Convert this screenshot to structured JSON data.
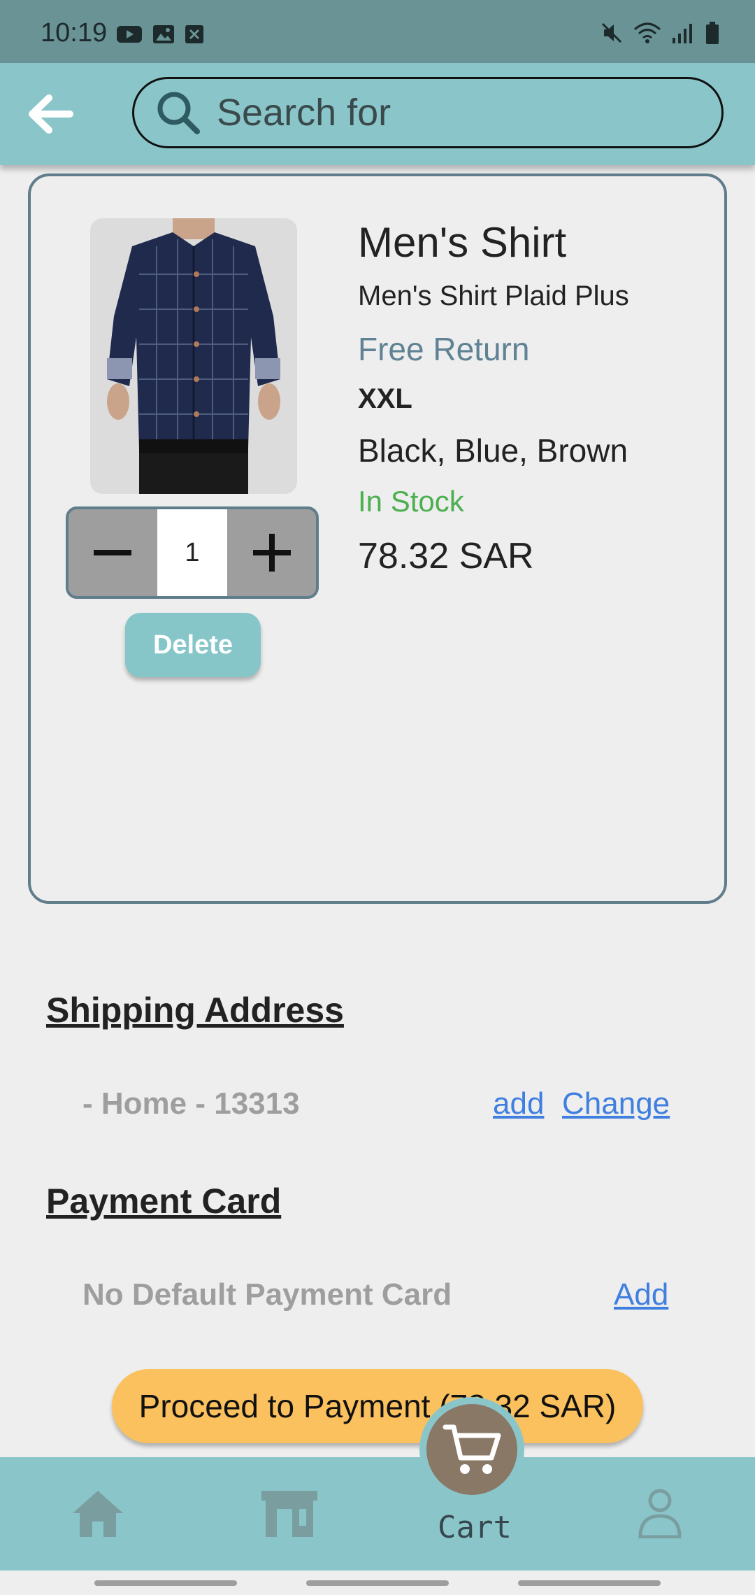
{
  "status_bar": {
    "time": "10:19"
  },
  "search": {
    "placeholder": "Search for"
  },
  "product": {
    "name": "Men's Shirt",
    "description": "Men's Shirt Plaid Plus",
    "return_policy": "Free Return",
    "size": "XXL",
    "colors": "Black, Blue, Brown",
    "stock": "In Stock",
    "price": "78.32 SAR",
    "quantity": "1",
    "delete_label": "Delete"
  },
  "shipping": {
    "title": "Shipping Address",
    "address": "- Home - 13313",
    "add_label": "add",
    "change_label": "Change"
  },
  "payment": {
    "title": "Payment Card",
    "status": "No Default Payment Card",
    "add_label": "Add"
  },
  "proceed_label": "Proceed to Payment (78.32 SAR)",
  "bottom_nav": {
    "cart_label": "Cart"
  },
  "colors": {
    "status_bar": "#6a9396",
    "appbar": "#8ac6c9",
    "accent_link": "#3f7fe0",
    "stock_green": "#4caf50",
    "proceed": "#fbc15e",
    "card_border": "#607d8b",
    "cart_fab": "#8a7866"
  },
  "icons": [
    "back-arrow-icon",
    "search-icon",
    "minus-icon",
    "plus-icon",
    "home-icon",
    "store-icon",
    "cart-icon",
    "person-icon"
  ]
}
